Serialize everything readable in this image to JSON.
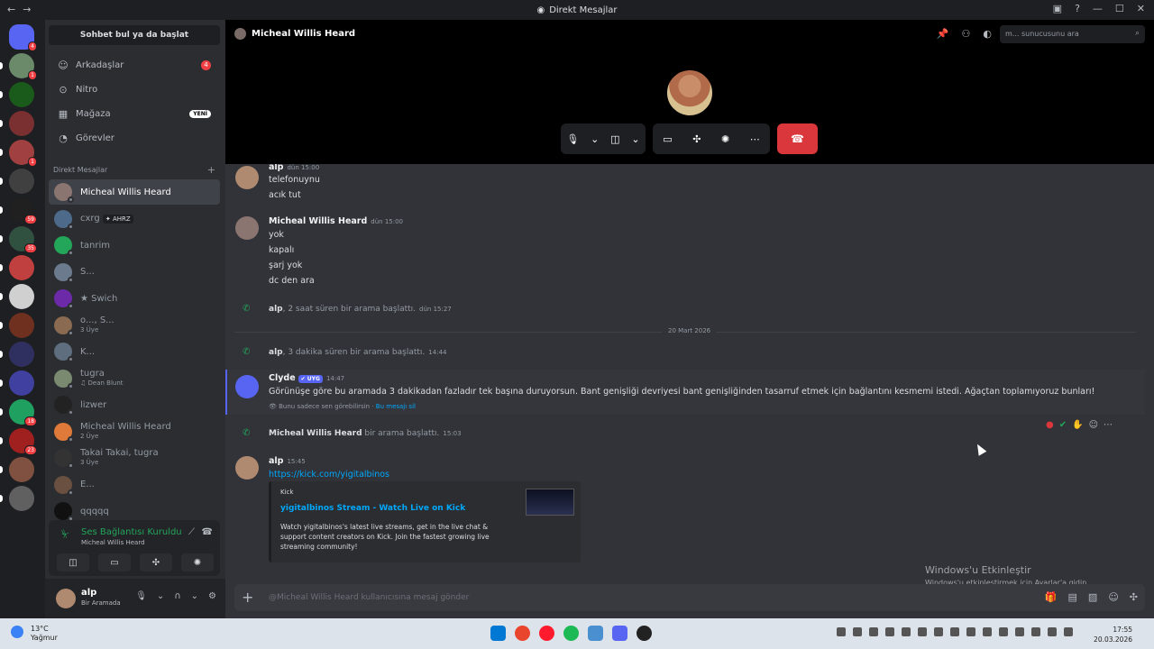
{
  "window": {
    "title": "Direkt Mesajlar",
    "back": "←",
    "fwd": "→"
  },
  "sidebar": {
    "search_label": "Sohbet bul ya da başlat",
    "nav": [
      {
        "label": "Arkadaşlar",
        "icon": "friends-icon",
        "badge": "4"
      },
      {
        "label": "Nitro",
        "icon": "nitro-icon"
      },
      {
        "label": "Mağaza",
        "icon": "shop-icon",
        "tag": "YENİ"
      },
      {
        "label": "Görevler",
        "icon": "quests-icon"
      }
    ],
    "dm_header": "Direkt Mesajlar",
    "dms": [
      {
        "name": "Micheal Willis Heard",
        "color": "#8a7570",
        "active": true
      },
      {
        "name": "cxrg",
        "extra": "✦ AHRZ",
        "color": "#4e6a8a"
      },
      {
        "name": "tanrim",
        "color": "#23a55a"
      },
      {
        "name": "S...",
        "color": "#6b7a8c"
      },
      {
        "name": "★ Swich",
        "color": "#6c2aa8"
      },
      {
        "name": "o..., S...",
        "sub": "3 Üye",
        "color": "#8a6a50"
      },
      {
        "name": "K...",
        "color": "#5e6e7e"
      },
      {
        "name": "tugra",
        "sub": "♫ Dean Blunt",
        "color": "#7a8a70"
      },
      {
        "name": "lizwer",
        "color": "#222"
      },
      {
        "name": "Micheal Willis Heard",
        "sub": "2 Üye",
        "color": "#e07a3a"
      },
      {
        "name": "Takai Takai, tugra",
        "sub": "3 Üye",
        "color": "#333"
      },
      {
        "name": "E...",
        "color": "#6a5040"
      },
      {
        "name": "qqqqq",
        "color": "#111"
      }
    ],
    "voice": {
      "status": "Ses Bağlantısı Kuruldu",
      "channel": "Micheal Willis Heard"
    },
    "user": {
      "name": "alp",
      "status": "Bir Aramada"
    }
  },
  "servers": [
    {
      "badge": "4",
      "color": "#5865f2"
    },
    {
      "badge": "1",
      "color": "#6a8a6a"
    },
    {
      "color": "#1a5a1a"
    },
    {
      "color": "#7a3030"
    },
    {
      "badge": "1",
      "color": "#a04040"
    },
    {
      "color": "#404040"
    },
    {
      "badge": "59",
      "color": "#202020"
    },
    {
      "badge": "35",
      "color": "#305040"
    },
    {
      "color": "#c04040"
    },
    {
      "color": "#d0d0d0"
    },
    {
      "color": "#703020"
    },
    {
      "color": "#303060"
    },
    {
      "color": "#4040a0"
    },
    {
      "badge": "18",
      "color": "#20a060"
    },
    {
      "badge": "23",
      "color": "#a02020"
    },
    {
      "color": "#805040"
    },
    {
      "color": "#606060"
    }
  ],
  "header": {
    "name": "Micheal Willis Heard",
    "search_placeholder": "m... sunucusunu ara"
  },
  "messages": {
    "m1": {
      "author": "alp",
      "time": "dün 15:00",
      "lines": [
        "telefonuynu",
        "acık tut"
      ]
    },
    "m2": {
      "author": "Micheal Willis Heard",
      "time": "dün 15:00",
      "lines": [
        "yok",
        "kapalı",
        "şarj yok",
        "dc den ara"
      ]
    },
    "s1": {
      "who": "alp",
      "text": ", 2 saat süren bir arama başlattı.",
      "time": "dün 15:27"
    },
    "date": "20 Mart 2026",
    "s2": {
      "who": "alp",
      "text": ", 3 dakika süren bir arama başlattı.",
      "time": "14:44"
    },
    "clyde": {
      "author": "Clyde",
      "tag": "✔ UYG",
      "time": "14:47",
      "text": "Görünüşe göre bu aramada 3 dakikadan fazladır tek başına duruyorsun. Bant genişliği devriyesi bant genişliğinden tasarruf etmek için bağlantını kesmemi istedi. Ağaçtan toplamıyoruz bunları!",
      "note": "Bunu sadece sen görebilirsin",
      "delete": "Bu mesajı sil"
    },
    "s3": {
      "who": "Micheal Willis Heard",
      "text": " bir arama başlattı.",
      "time": "15:03"
    },
    "m3": {
      "author": "alp",
      "time": "15:45",
      "link": "https://kick.com/yigitalbinos",
      "embed": {
        "provider": "Kick",
        "title": "yigitalbinos Stream - Watch Live on Kick",
        "desc": "Watch yigitalbinos's latest live streams, get in the live chat & support content creators on Kick. Join the fastest growing live streaming community!"
      }
    }
  },
  "composer": {
    "placeholder": "@Micheal Willis Heard kullanıcısına mesaj gönder"
  },
  "watermark": {
    "title": "Windows'u Etkinleştir",
    "sub": "Windows'u etkinleştirmek için Ayarlar'a gidin."
  },
  "taskbar": {
    "temp": "13°C",
    "weather": "Yağmur",
    "time": "17:55",
    "date": "20.03.2026"
  }
}
